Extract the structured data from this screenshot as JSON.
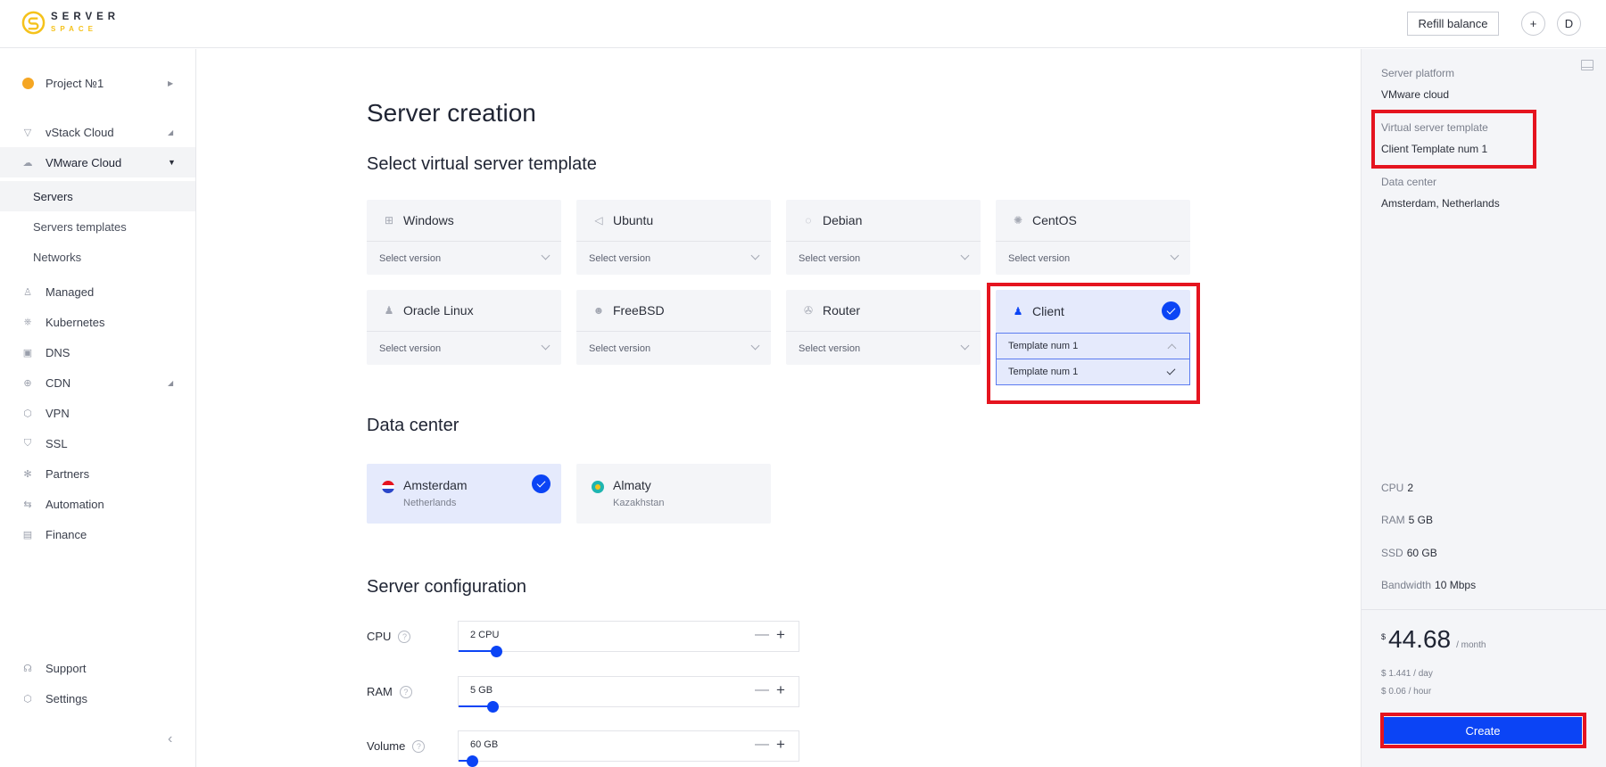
{
  "header": {
    "logo_top": "SERVER",
    "logo_bottom": "SPACE",
    "refill_label": "Refill balance",
    "add_label": "+",
    "avatar_letter": "D"
  },
  "sidebar": {
    "project": "Project №1",
    "items": [
      {
        "label": "vStack Cloud",
        "icon": "vstack-icon"
      },
      {
        "label": "VMware Cloud",
        "icon": "cloud-icon"
      },
      {
        "label": "Managed",
        "icon": "managed-icon"
      },
      {
        "label": "Kubernetes",
        "icon": "kubernetes-icon"
      },
      {
        "label": "DNS",
        "icon": "dns-icon"
      },
      {
        "label": "CDN",
        "icon": "globe-icon"
      },
      {
        "label": "VPN",
        "icon": "vpn-icon"
      },
      {
        "label": "SSL",
        "icon": "shield-icon"
      },
      {
        "label": "Partners",
        "icon": "snowflake-icon"
      },
      {
        "label": "Automation",
        "icon": "arrows-icon"
      },
      {
        "label": "Finance",
        "icon": "document-icon"
      }
    ],
    "vmware_sub": [
      {
        "label": "Servers"
      },
      {
        "label": "Servers templates"
      },
      {
        "label": "Networks"
      }
    ],
    "bottom": [
      {
        "label": "Support",
        "icon": "headset-icon"
      },
      {
        "label": "Settings",
        "icon": "settings-icon"
      }
    ]
  },
  "main": {
    "title": "Server creation",
    "template_heading": "Select virtual server template",
    "select_placeholder": "Select version",
    "templates": [
      {
        "name": "Windows",
        "icon": "windows-icon"
      },
      {
        "name": "Ubuntu",
        "icon": "ubuntu-icon"
      },
      {
        "name": "Debian",
        "icon": "debian-icon"
      },
      {
        "name": "CentOS",
        "icon": "centos-icon"
      },
      {
        "name": "Oracle Linux",
        "icon": "oracle-icon"
      },
      {
        "name": "FreeBSD",
        "icon": "freebsd-icon"
      },
      {
        "name": "Router",
        "icon": "router-icon"
      },
      {
        "name": "Client",
        "icon": "client-icon",
        "selected": true,
        "selected_version": "Template num 1",
        "options": [
          "Template num 1"
        ]
      }
    ],
    "datacenter_heading": "Data center",
    "datacenters": [
      {
        "city": "Amsterdam",
        "country": "Netherlands",
        "selected": true
      },
      {
        "city": "Almaty",
        "country": "Kazakhstan",
        "selected": false
      }
    ],
    "config_heading": "Server configuration",
    "config": [
      {
        "label": "CPU",
        "value": "2 CPU",
        "slider_fraction": 0.11
      },
      {
        "label": "RAM",
        "value": "5 GB",
        "slider_fraction": 0.1
      },
      {
        "label": "Volume",
        "value": "60 GB",
        "slider_fraction": 0.04
      }
    ],
    "minus_label": "—",
    "plus_label": "+"
  },
  "summary": {
    "platform_label": "Server platform",
    "platform_value": "VMware cloud",
    "template_label": "Virtual server template",
    "template_value": "Client Template num 1",
    "dc_label": "Data center",
    "dc_value": "Amsterdam, Netherlands",
    "specs": [
      {
        "label": "CPU",
        "value": "2"
      },
      {
        "label": "RAM",
        "value": "5 GB"
      },
      {
        "label": "SSD",
        "value": "60 GB"
      },
      {
        "label": "Bandwidth",
        "value": "10 Mbps"
      }
    ],
    "currency": "$",
    "monthly": "44.68",
    "per_month": "/ month",
    "daily": "$ 1.441 / day",
    "hourly": "$ 0.06 / hour",
    "create_label": "Create"
  },
  "colors": {
    "accent": "#0b44f5",
    "highlight": "#e5141f",
    "brand": "#f5c21b"
  }
}
